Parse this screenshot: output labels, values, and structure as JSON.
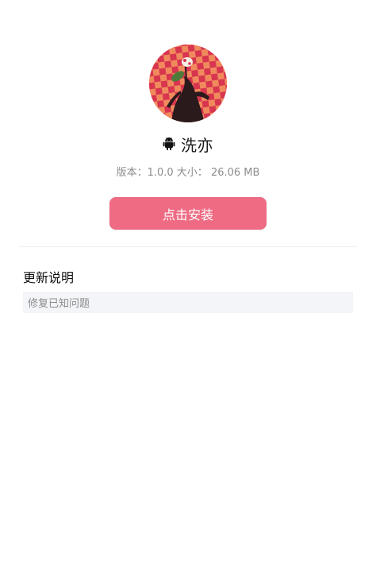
{
  "app": {
    "icon": "app-artwork-icon",
    "name": "洗亦",
    "platform_icon": "android-icon"
  },
  "meta": {
    "version_label": "版本：",
    "version_value": "1.0.0",
    "size_label": "大小：",
    "size_value": "26.06 MB"
  },
  "install": {
    "label": "点击安装",
    "color": "#ee6b83"
  },
  "release_notes": {
    "title": "更新说明",
    "content": "修复已知问题"
  },
  "colors": {
    "accent": "#ee6b83",
    "muted_text": "#8c8c8c",
    "notes_background": "#f3f5f8"
  }
}
